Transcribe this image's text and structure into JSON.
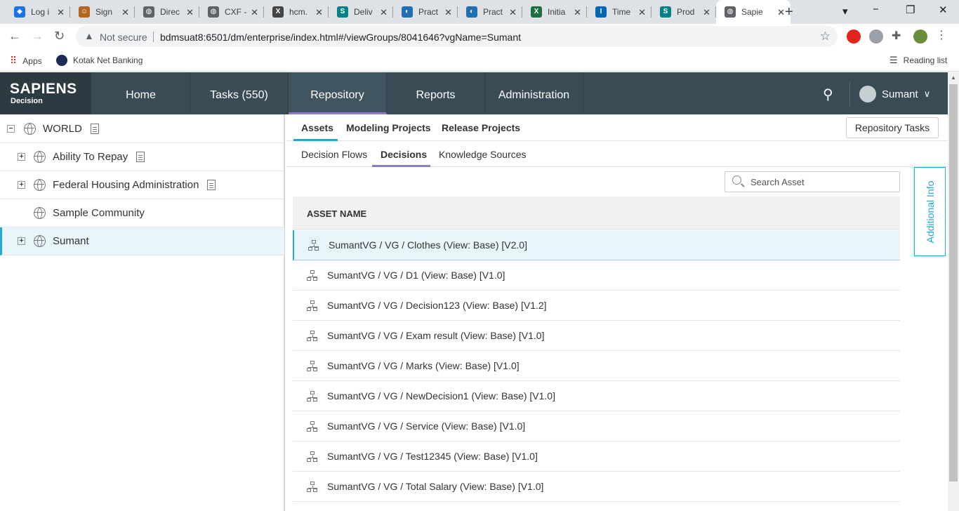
{
  "browser": {
    "tabs": [
      {
        "label": "Log i",
        "color": "#1a73e8",
        "glyph": "◆"
      },
      {
        "label": "Sign",
        "color": "#b5651d",
        "glyph": "☺"
      },
      {
        "label": "Direc",
        "color": "#5f6368",
        "glyph": "◍"
      },
      {
        "label": "CXF -",
        "color": "#5f6368",
        "glyph": "◍"
      },
      {
        "label": "hcm.",
        "color": "#444444",
        "glyph": "X"
      },
      {
        "label": "Deliv",
        "color": "#038387",
        "glyph": "S"
      },
      {
        "label": "Pract",
        "color": "#1f6fb2",
        "glyph": "◐"
      },
      {
        "label": "Pract",
        "color": "#1f6fb2",
        "glyph": "◐"
      },
      {
        "label": "Initia",
        "color": "#1d6f42",
        "glyph": "X"
      },
      {
        "label": "Time",
        "color": "#0067b8",
        "glyph": "I"
      },
      {
        "label": "Prod",
        "color": "#038387",
        "glyph": "S"
      },
      {
        "label": "Sapie",
        "color": "#5f6368",
        "glyph": "◍"
      }
    ],
    "new_tab": "+",
    "security": "Not secure",
    "url": "bdmsuat8:6501/dm/enterprise/index.html#/viewGroups/8041646?vgName=Sumant",
    "bookmarks": {
      "apps": "Apps",
      "kotak": "Kotak Net Banking",
      "reading_list": "Reading list"
    }
  },
  "header": {
    "logo_main": "SAPIENS",
    "logo_sub": "Decision",
    "nav": [
      "Home",
      "Tasks  (550)",
      "Repository",
      "Reports",
      "Administration"
    ],
    "active_nav": "Repository",
    "user": "Sumant"
  },
  "tree": {
    "items": [
      {
        "label": "WORLD",
        "expand": "−",
        "doc": true
      },
      {
        "label": "Ability To Repay",
        "expand": "+",
        "doc": true
      },
      {
        "label": "Federal Housing Administration",
        "expand": "+",
        "doc": true
      },
      {
        "label": "Sample Community",
        "expand": "",
        "doc": false
      },
      {
        "label": "Sumant",
        "expand": "+",
        "doc": false
      }
    ]
  },
  "main": {
    "tabs": [
      "Assets",
      "Modeling Projects",
      "Release Projects"
    ],
    "active_tab": "Assets",
    "repo_tasks": "Repository Tasks",
    "subtabs": [
      "Decision Flows",
      "Decisions",
      "Knowledge Sources"
    ],
    "active_subtab": "Decisions",
    "search_placeholder": "Search Asset",
    "column_header": "ASSET NAME",
    "assets": [
      "SumantVG / VG / Clothes (View: Base) [V2.0]",
      "SumantVG / VG / D1 (View: Base) [V1.0]",
      "SumantVG / VG / Decision123 (View: Base) [V1.2]",
      "SumantVG / VG / Exam result (View: Base) [V1.0]",
      "SumantVG / VG / Marks (View: Base) [V1.0]",
      "SumantVG / VG / NewDecision1 (View: Base) [V1.0]",
      "SumantVG / VG / Service (View: Base) [V1.0]",
      "SumantVG / VG / Test12345 (View: Base) [V1.0]",
      "SumantVG / VG / Total Salary (View: Base) [V1.0]"
    ],
    "additional_info": "Additional Info"
  },
  "colors": {
    "accent": "#23a9d8",
    "header_bg": "#394b55",
    "nav_underline": "#8e7cc3"
  }
}
